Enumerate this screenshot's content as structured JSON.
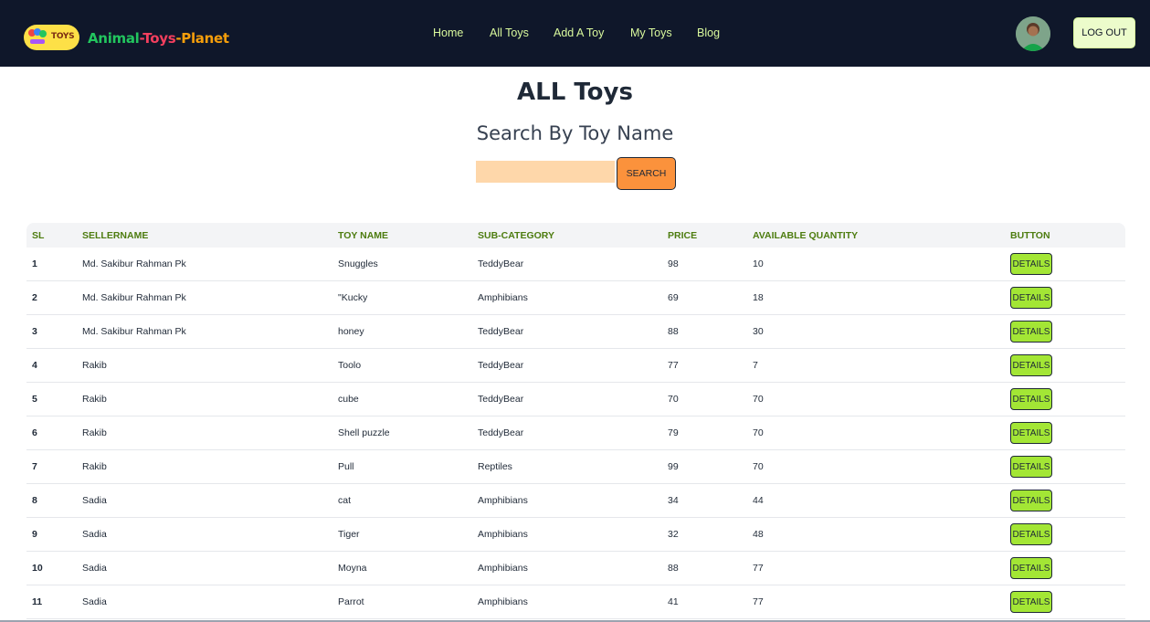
{
  "brand": {
    "logo_text": "TOYS",
    "part1": "Animal",
    "sep1": "-",
    "part2": "Toys",
    "sep2": "-",
    "part3": "Planet"
  },
  "nav": {
    "links": [
      {
        "label": "Home"
      },
      {
        "label": "All Toys"
      },
      {
        "label": "Add A Toy"
      },
      {
        "label": "My Toys"
      },
      {
        "label": "Blog"
      }
    ],
    "logout_label": "LOG OUT"
  },
  "main": {
    "title": "ALL Toys",
    "search_heading": "Search By Toy Name",
    "search_value": "",
    "search_button": "SEARCH"
  },
  "table": {
    "headers": [
      "SL",
      "SELLERNAME",
      "TOY NAME",
      "SUB-CATEGORY",
      "PRICE",
      "AVAILABLE QUANTITY",
      "BUTTON"
    ],
    "button_label": "DETAILS",
    "rows": [
      {
        "sl": "1",
        "seller": "Md. Sakibur Rahman Pk",
        "toy": "Snuggles",
        "category": "TeddyBear",
        "price": "98",
        "qty": "10"
      },
      {
        "sl": "2",
        "seller": "Md. Sakibur Rahman Pk",
        "toy": "\"Kucky",
        "category": "Amphibians",
        "price": "69",
        "qty": "18"
      },
      {
        "sl": "3",
        "seller": "Md. Sakibur Rahman Pk",
        "toy": "honey",
        "category": "TeddyBear",
        "price": "88",
        "qty": "30"
      },
      {
        "sl": "4",
        "seller": "Rakib",
        "toy": "Toolo",
        "category": "TeddyBear",
        "price": "77",
        "qty": "7"
      },
      {
        "sl": "5",
        "seller": "Rakib",
        "toy": "cube",
        "category": "TeddyBear",
        "price": "70",
        "qty": "70"
      },
      {
        "sl": "6",
        "seller": "Rakib",
        "toy": "Shell puzzle",
        "category": "TeddyBear",
        "price": "79",
        "qty": "70"
      },
      {
        "sl": "7",
        "seller": "Rakib",
        "toy": "Pull",
        "category": "Reptiles",
        "price": "99",
        "qty": "70"
      },
      {
        "sl": "8",
        "seller": "Sadia",
        "toy": "cat",
        "category": "Amphibians",
        "price": "34",
        "qty": "44"
      },
      {
        "sl": "9",
        "seller": "Sadia",
        "toy": "Tiger",
        "category": "Amphibians",
        "price": "32",
        "qty": "48"
      },
      {
        "sl": "10",
        "seller": "Sadia",
        "toy": "Moyna",
        "category": "Amphibians",
        "price": "88",
        "qty": "77"
      },
      {
        "sl": "11",
        "seller": "Sadia",
        "toy": "Parrot",
        "category": "Amphibians",
        "price": "41",
        "qty": "77"
      }
    ]
  }
}
